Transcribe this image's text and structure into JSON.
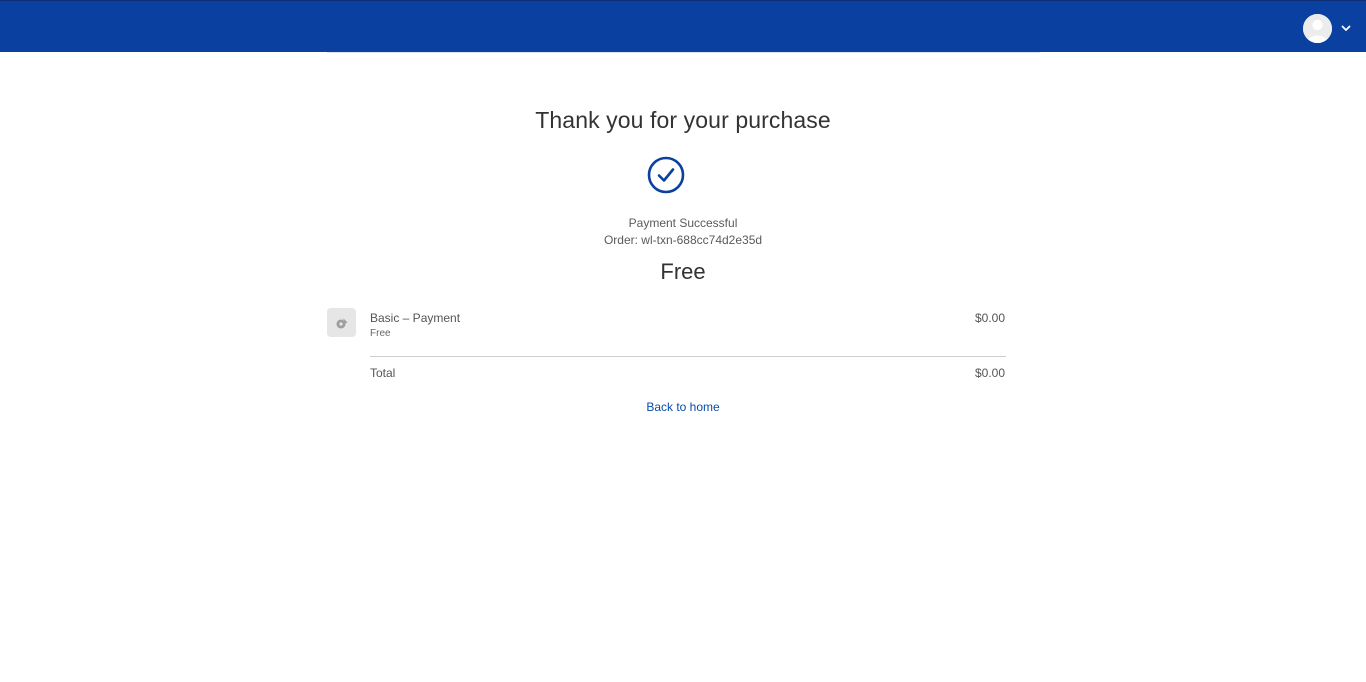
{
  "header": {
    "accent_color": "#0a40a0",
    "user_menu": {
      "avatar_icon": "user-avatar-icon",
      "dropdown_icon": "chevron-down-icon"
    }
  },
  "confirmation": {
    "title": "Thank you for your purchase",
    "status_icon": "check-circle-icon",
    "status_text": "Payment Successful",
    "order_text": "Order: wl-txn-688cc74d2e35d",
    "price_label": "Free"
  },
  "order_summary": {
    "items": [
      {
        "icon": "product-placeholder-icon",
        "name": "Basic – Payment",
        "subtitle": "Free",
        "price": "$0.00"
      }
    ],
    "total_label": "Total",
    "total_value": "$0.00"
  },
  "links": {
    "back_to_home": "Back to home"
  }
}
